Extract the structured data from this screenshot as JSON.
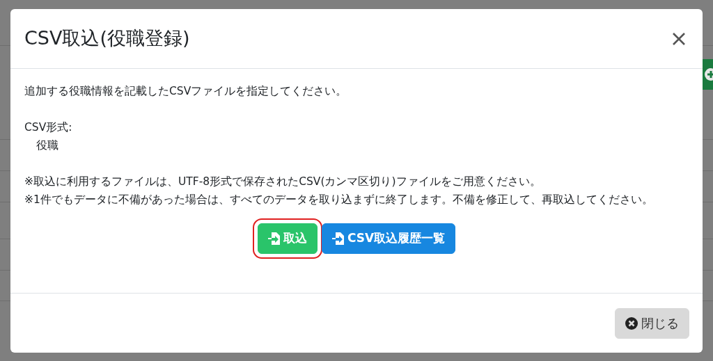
{
  "dialog": {
    "title": "CSV取込(役職登録)",
    "intro": "追加する役職情報を記載したCSVファイルを指定してください。",
    "format_label": "CSV形式:",
    "format_value": "役職",
    "notes": [
      "※取込に利用するファイルは、UTF-8形式で保存されたCSV(カンマ区切り)ファイルをご用意ください。",
      "※1件でもデータに不備があった場合は、すべてのデータを取り込まずに終了します。不備を修正して、再取込してください。"
    ],
    "buttons": [
      {
        "label": "取込",
        "kind": "success",
        "highlighted": true
      },
      {
        "label": "CSV取込履歴一覧",
        "kind": "primary",
        "highlighted": false
      }
    ],
    "close_button": {
      "label": "閉じる"
    }
  }
}
